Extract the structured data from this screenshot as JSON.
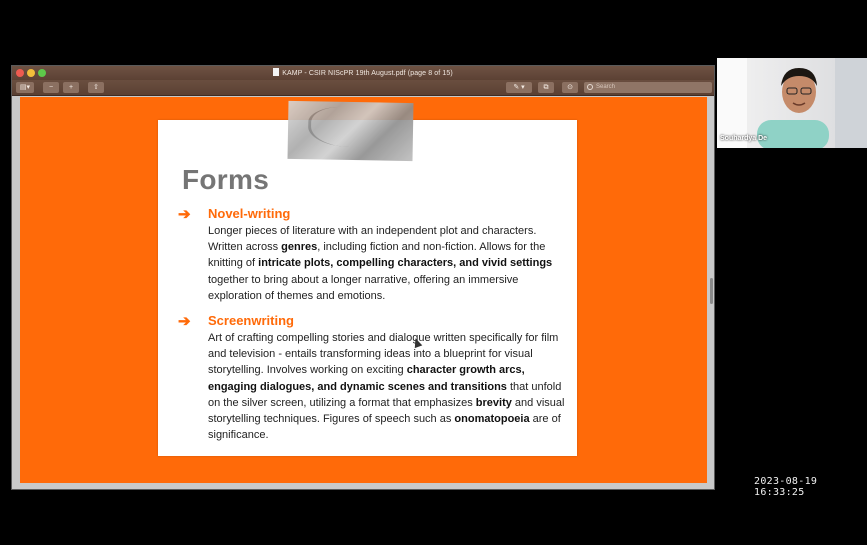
{
  "window": {
    "title": "KAMP - CSIR NIScPR 19th August.pdf (page 8 of 15)",
    "search_placeholder": "Search"
  },
  "toolbar": {
    "sidebar_label": "▤▾",
    "zoom_out_label": "−",
    "zoom_in_label": "+",
    "share_label": "⇧",
    "markup_label": "✎ ▾",
    "rotate_label": "⧉",
    "annotate_label": "⊙"
  },
  "slide": {
    "title": "Forms",
    "sections": [
      {
        "heading": "Novel-writing",
        "body": [
          {
            "t": "Longer pieces of literature with an independent plot and characters. Written across ",
            "b": false
          },
          {
            "t": "genres",
            "b": true
          },
          {
            "t": ", including fiction and non-fiction. Allows for the knitting of ",
            "b": false
          },
          {
            "t": "intricate plots, compelling characters, and vivid settings",
            "b": true
          },
          {
            "t": " together to bring about a longer narrative, offering an immersive exploration of themes and emotions.",
            "b": false
          }
        ]
      },
      {
        "heading": "Screenwriting",
        "body": [
          {
            "t": "Art of crafting compelling stories and dialogue written specifically for film and television - entails transforming ideas into a blueprint for visual storytelling. Involves working on exciting ",
            "b": false
          },
          {
            "t": "character growth arcs, engaging dialogues, and dynamic scenes and transitions",
            "b": true
          },
          {
            "t": " that unfold on the silver screen, utilizing a format that emphasizes ",
            "b": false
          },
          {
            "t": "brevity",
            "b": true
          },
          {
            "t": " and visual storytelling techniques. Figures of speech such as ",
            "b": false
          },
          {
            "t": "onomatopoeia",
            "b": true
          },
          {
            "t": " are of significance.",
            "b": false
          }
        ]
      }
    ],
    "arrow_glyph": "➔"
  },
  "webcam": {
    "participant_name": "Souhardya De"
  },
  "timestamp": "2023-08-19 16:33:25",
  "colors": {
    "accent": "#ff6a09",
    "title_gray": "#757575"
  }
}
